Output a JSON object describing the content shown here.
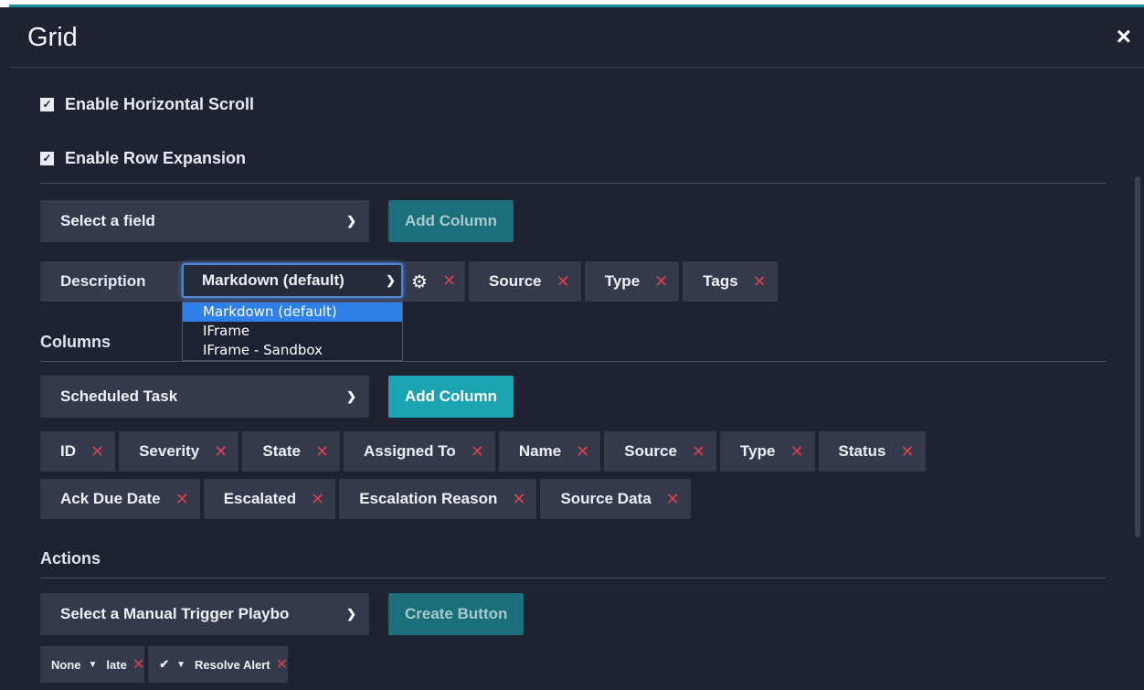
{
  "dialog": {
    "title": "Grid",
    "close_icon": "×"
  },
  "options": {
    "horizontal_scroll_label": "Enable Horizontal Scroll",
    "row_expansion_label": "Enable Row Expansion",
    "check_glyph": "✓"
  },
  "expansion": {
    "field_select": "Select a field",
    "add_button": "Add Column",
    "chips": [
      {
        "label": "Description",
        "format_value": "Markdown (default)"
      },
      {
        "label": "Source"
      },
      {
        "label": "Type"
      },
      {
        "label": "Tags"
      }
    ],
    "format_options": [
      "Markdown (default)",
      "IFrame",
      "IFrame - Sandbox"
    ]
  },
  "columns": {
    "section_label": "Columns",
    "field_select": "Scheduled Task",
    "add_button": "Add Column",
    "row1": [
      "ID",
      "Severity",
      "State",
      "Assigned To",
      "Name",
      "Source",
      "Type",
      "Status"
    ],
    "row2": [
      "Ack Due Date",
      "Escalated",
      "Escalation Reason",
      "Source Data"
    ]
  },
  "actions": {
    "section_label": "Actions",
    "playbook_select": "Select a Manual Trigger Playbo",
    "create_button": "Create Button",
    "chips": [
      {
        "icon": "None",
        "label": "late"
      },
      {
        "icon": "✔",
        "label": "Resolve Alert"
      }
    ]
  },
  "glyphs": {
    "remove": "✕",
    "caret": "▼",
    "chevron": "⌄",
    "gear": "⚙"
  }
}
